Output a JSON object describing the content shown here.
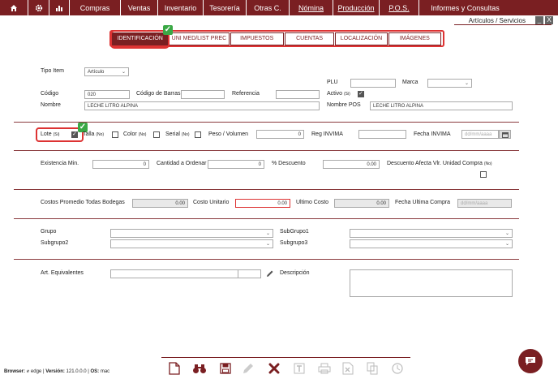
{
  "nav": {
    "icons": [
      "home-icon",
      "gear-icon",
      "bar-chart-icon"
    ],
    "items": [
      "Compras",
      "Ventas",
      "Inventario",
      "Tesorería",
      "Otras C.",
      "Nómina",
      "Producción",
      "P.O.S.",
      "Informes y Consultas"
    ]
  },
  "window": {
    "title": "Artículos / Servicios",
    "minimize": "_",
    "close": "X"
  },
  "tabs": [
    "IDENTIFICACIÓN",
    "UNI MED/LIST PREC",
    "IMPUESTOS",
    "CUENTAS",
    "LOCALIZACIÓN",
    "IMÁGENES"
  ],
  "form": {
    "tipo_item_label": "Tipo Item",
    "tipo_item_value": "Artículo",
    "plu_label": "PLU",
    "plu_value": "",
    "marca_label": "Marca",
    "marca_value": "",
    "codigo_label": "Código",
    "codigo_value": "020",
    "codigo_barras_label": "Código de Barras",
    "codigo_barras_value": "",
    "referencia_label": "Referencia",
    "referencia_value": "",
    "activo_label": "Activo",
    "activo_hint": "(Si)",
    "nombre_label": "Nombre",
    "nombre_value": "LECHE LITRO ALPINA",
    "nombre_pos_label": "Nombre POS",
    "nombre_pos_value": "LECHE LITRO ALPINA",
    "lote_label": "Lote",
    "lote_hint": "(Si)",
    "talla_label": "Talla",
    "talla_hint": "(No)",
    "color_label": "Color",
    "color_hint": "(No)",
    "serial_label": "Serial",
    "serial_hint": "(No)",
    "peso_label": "Peso / Volumen",
    "peso_value": "0",
    "reg_invima_label": "Reg INVIMA",
    "reg_invima_value": "",
    "fecha_invima_label": "Fecha INVIMA",
    "fecha_invima_placeholder": "dd/mm/aaaa",
    "existencia_label": "Existencia Min.",
    "existencia_value": "0",
    "cantidad_label": "Cantidad a Ordenar",
    "cantidad_value": "0",
    "descuento_label": "% Descuento",
    "descuento_value": "0.00",
    "desc_afecta_label": "Descuento Afecta Vlr. Unidad Compra",
    "desc_afecta_hint": "(No)",
    "costos_label": "Costos Promedio Todas Bodegas",
    "costos_value": "0.00",
    "costo_unit_label": "Costo Unitario",
    "costo_unit_value": "0.00",
    "ultimo_costo_label": "Ultimo Costo",
    "ultimo_costo_value": "0.00",
    "fecha_ult_label": "Fecha Ultima Compra",
    "fecha_ult_placeholder": "dd/mm/aaaa",
    "grupo_label": "Grupo",
    "subgrupo1_label": "SubGrupo1",
    "subgrupo2_label": "Subgrupo2",
    "subgrupo3_label": "Subgrupo3",
    "art_equiv_label": "Art. Equivalentes",
    "descripcion_label": "Descripción"
  },
  "footer": {
    "browser_label": "Browser:",
    "browser_value": "edge",
    "version_label": "Versión:",
    "version_value": "121.0.0.0",
    "os_label": "OS:",
    "os_value": "mac"
  },
  "colors": {
    "brand": "#7a1f22",
    "highlight": "#dd3333",
    "check": "#3aa845"
  }
}
